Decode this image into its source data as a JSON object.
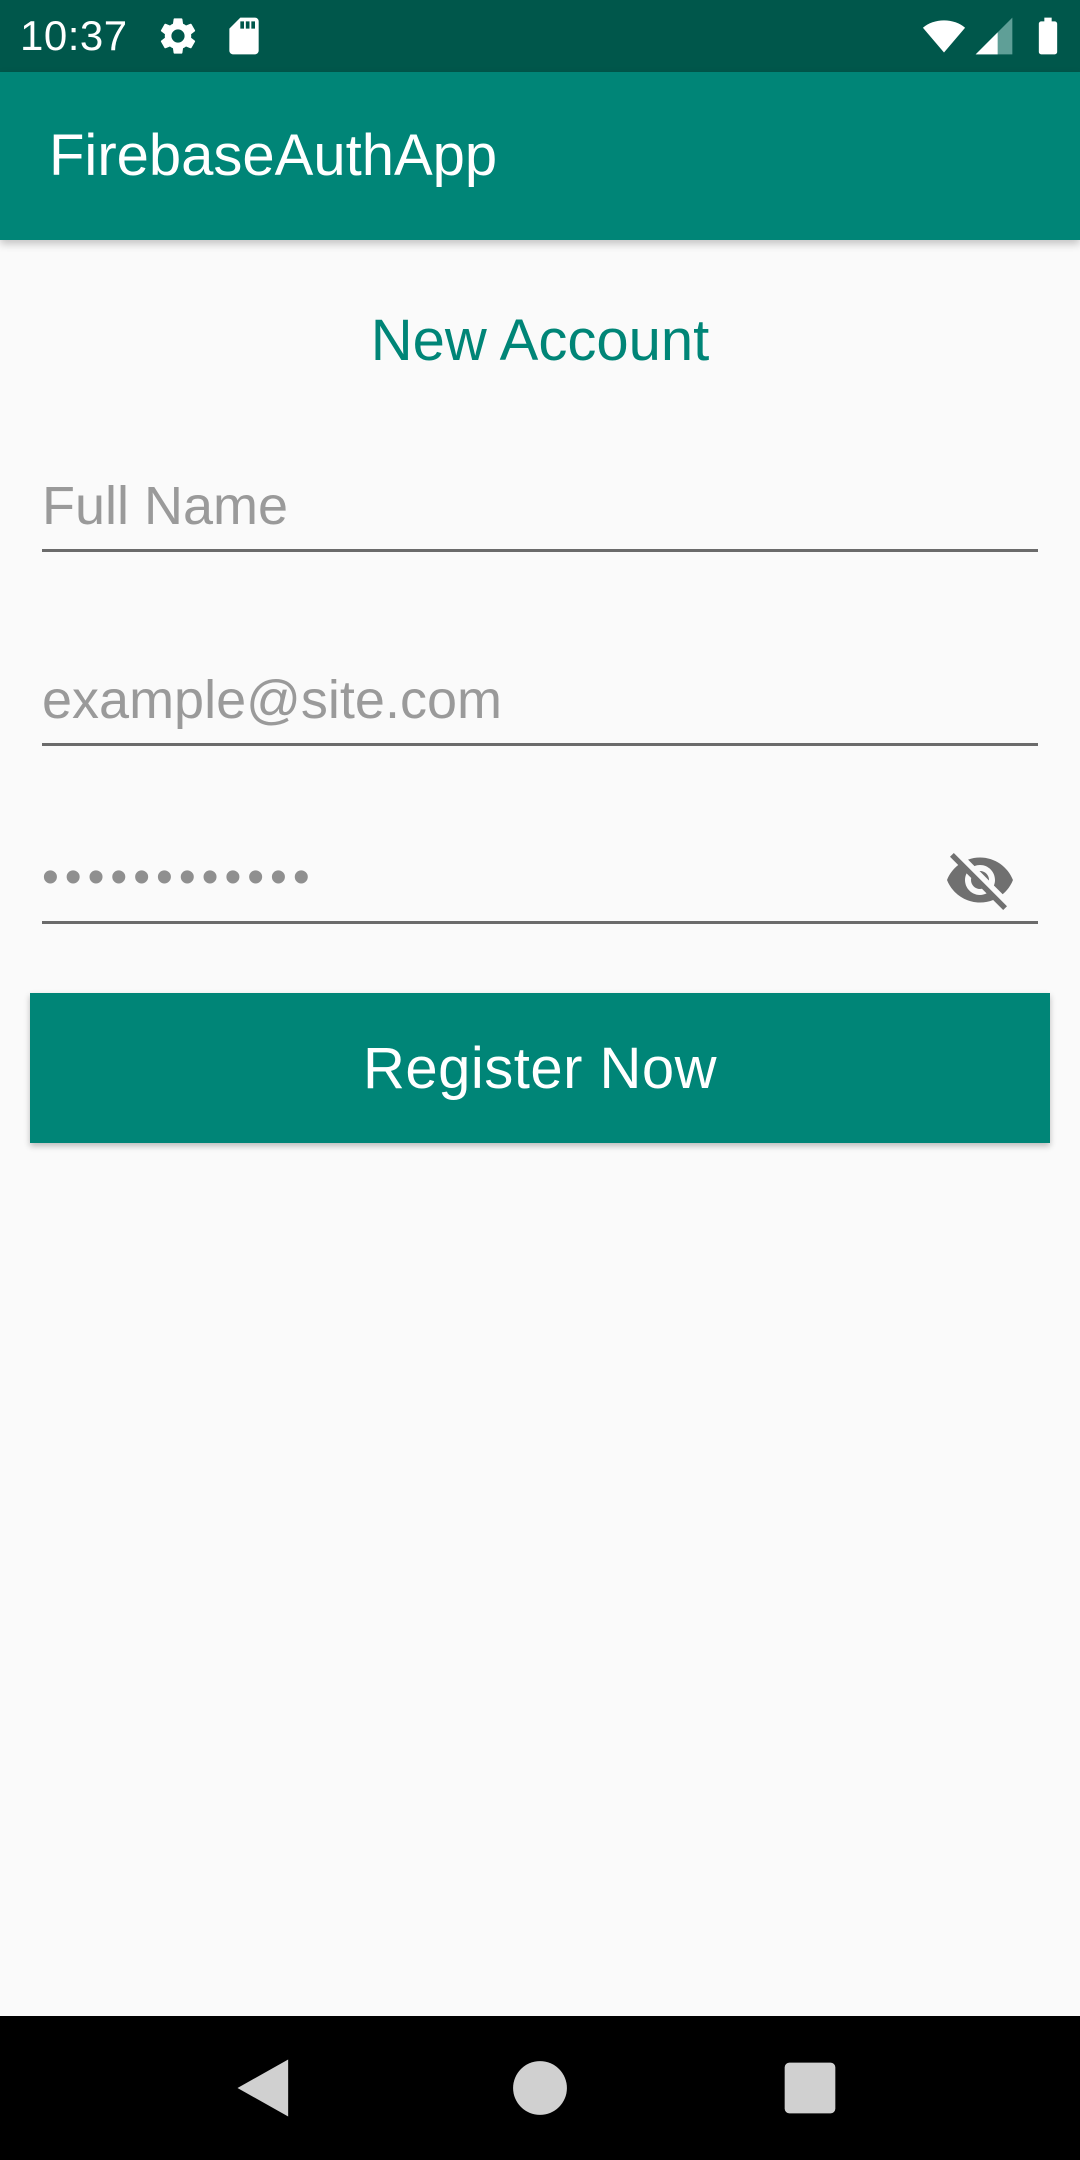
{
  "status_bar": {
    "time": "10:37",
    "icons": [
      "gear-icon",
      "sd-card-icon",
      "wifi-icon",
      "signal-icon",
      "battery-icon"
    ]
  },
  "app_bar": {
    "title": "FirebaseAuthApp"
  },
  "form": {
    "heading": "New Account",
    "full_name": {
      "placeholder": "Full Name",
      "value": ""
    },
    "email": {
      "placeholder": "example@site.com",
      "value": ""
    },
    "password": {
      "masked_value": "••••••••••••",
      "toggle_icon": "visibility-off-icon"
    },
    "register_label": "Register Now"
  },
  "nav_bar": {
    "icons": [
      "back-icon",
      "home-icon",
      "recents-icon"
    ]
  },
  "colors": {
    "primary": "#008577",
    "primary_dark": "#00574b",
    "background": "#fafafa",
    "hint_text": "#9a9a9a"
  }
}
